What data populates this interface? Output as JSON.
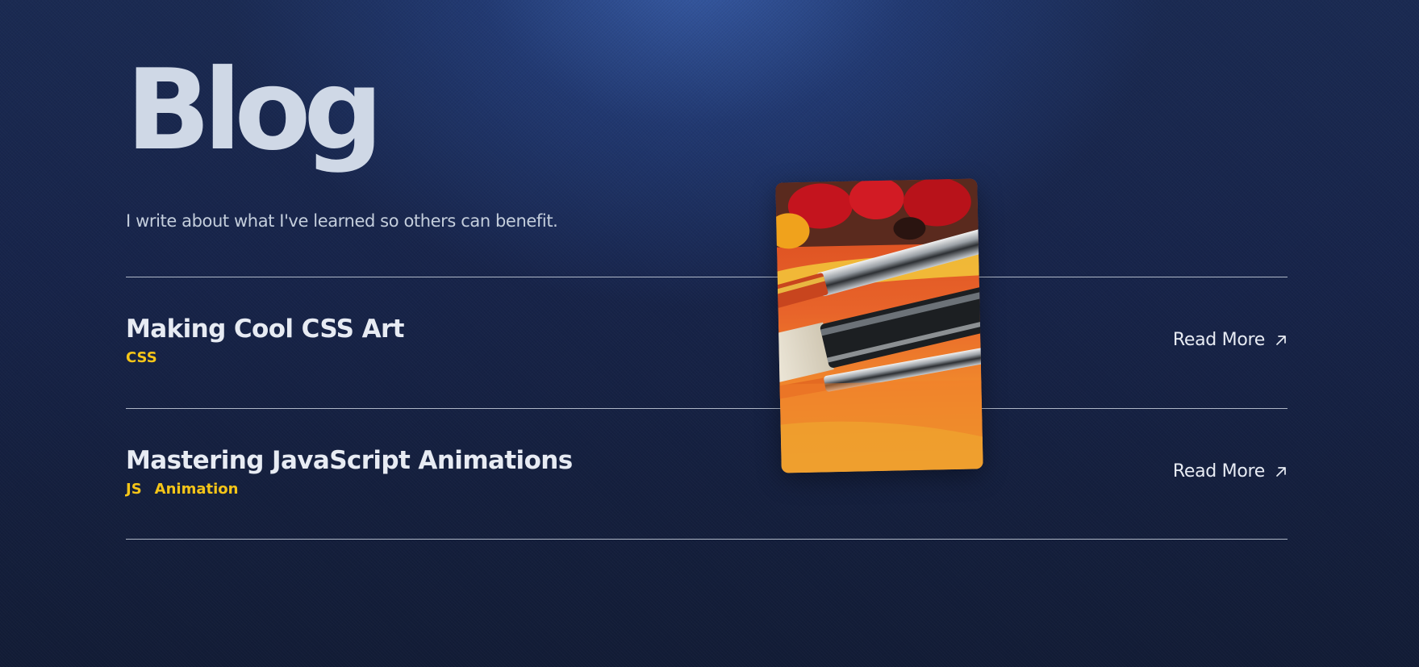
{
  "page": {
    "title": "Blog",
    "subtitle": "I write about what I've learned so others can benefit."
  },
  "posts": [
    {
      "title": "Making Cool CSS Art",
      "tags": [
        "CSS"
      ],
      "link_label": "Read More"
    },
    {
      "title": "Mastering JavaScript Animations",
      "tags": [
        "JS",
        "Animation"
      ],
      "link_label": "Read More"
    }
  ],
  "icons": {
    "read_more": "arrow-up-right-icon"
  },
  "colors": {
    "background": "#17244a",
    "glow": "#2e4f96",
    "title_text": "#cfd8e6",
    "tag_accent": "#f5c518",
    "divider": "#c9d1de"
  },
  "preview_image": {
    "subject": "paint brushes on orange paint with red and yellow paint blobs"
  }
}
